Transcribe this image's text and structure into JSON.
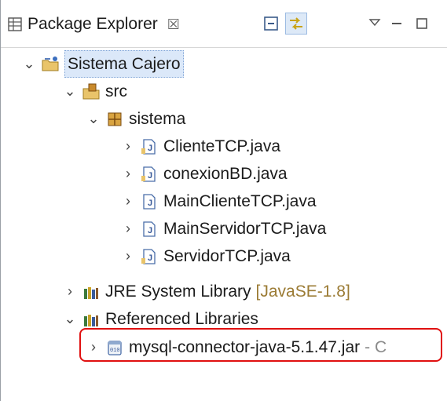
{
  "tab": {
    "title": "Package Explorer",
    "close_glyph": "☒"
  },
  "toolbar": {
    "buttons": [
      {
        "name": "collapse-all-icon"
      },
      {
        "name": "link-with-editor-icon"
      },
      {
        "name": "view-menu-icon"
      },
      {
        "name": "minimize-icon"
      },
      {
        "name": "maximize-icon"
      }
    ]
  },
  "tree": {
    "project": "Sistema Cajero",
    "src": "src",
    "package": "sistema",
    "files": [
      "ClienteTCP.java",
      "conexionBD.java",
      "MainClienteTCP.java",
      "MainServidorTCP.java",
      "ServidorTCP.java"
    ],
    "jre_label": "JRE System Library",
    "jre_suffix": "[JavaSE-1.8]",
    "ref_libs": "Referenced Libraries",
    "jar": "mysql-connector-java-5.1.47.jar",
    "jar_suffix": "- C"
  },
  "colors": {
    "highlight_border": "#e01010",
    "selection_bg": "#dbe8f9"
  }
}
